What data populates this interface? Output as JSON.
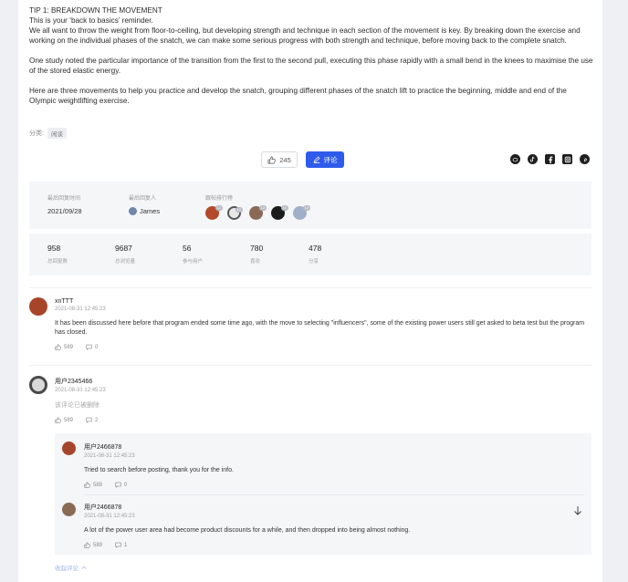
{
  "article": {
    "heading": "TIP 1: BREAKDOWN THE MOVEMENT",
    "line2": "This is your ‘back to basics’ reminder.",
    "para1": "We all want to throw the weight from floor-to-ceiling, but developing strength and technique in each section of the movement is key. By breaking down the exercise and working on the individual phases of the snatch, we can make some serious progress with both strength and technique, before moving back to the complete snatch.",
    "para2": "One study noted the particular importance of the transition from the first to the second pull, executing this phase rapidly with a small bend in the knees to maximise the use of the stored elastic energy.",
    "para3": "Here are three movements to help you practice and develop the snatch, grouping different phases of the snatch lift to practice the beginning, middle and end of the Olympic weightlifting exercise."
  },
  "category": {
    "label": "分类:",
    "tag": "闲谈"
  },
  "actions": {
    "like_count": "245",
    "comment_label": "评论"
  },
  "share_icons": [
    "weibo-icon",
    "tiktok-icon",
    "facebook-icon",
    "instagram-icon",
    "pinterest-icon"
  ],
  "info": {
    "last_reply_label": "最后回复时间",
    "last_reply_value": "2021/09/28",
    "last_replier_label": "最后回复人",
    "last_replier_value": "James",
    "ranking_label": "跟帖排行榜",
    "ranking_badges": [
      "12",
      "12",
      "12",
      "12",
      "12"
    ]
  },
  "stats": [
    {
      "value": "958",
      "label": "总回复数"
    },
    {
      "value": "9687",
      "label": "总浏览量"
    },
    {
      "value": "56",
      "label": "参与用户"
    },
    {
      "value": "780",
      "label": "喜欢"
    },
    {
      "value": "478",
      "label": "分享"
    }
  ],
  "comments": [
    {
      "name": "xnTTT",
      "time": "2021-08-31 12:45:23",
      "text": "It has been discussed here before that program ended some time ago, with the move to selecting \"influencers\", some of the existing power users still get asked to beta test but the program has closed.",
      "likes": "589",
      "replies": "0"
    },
    {
      "name": "用户2345466",
      "time": "2021-08-31 12:45:23",
      "text": "该评论已被删除",
      "likes": "589",
      "replies": "2"
    }
  ],
  "replies": [
    {
      "name": "用户2466878",
      "time": "2021-08-31 12:45:23",
      "text": "Tried to search before posting, thank you for the info.",
      "likes": "589",
      "replies": "0"
    },
    {
      "name": "用户2466878",
      "time": "2021-08-31 12:45:23",
      "text": "A lot of the power user area had become product discounts for a while, and then dropped into being almost nothing.",
      "likes": "589",
      "replies": "1"
    }
  ],
  "collapse_label": "收起评论",
  "colors": {
    "accent": "#2f5bea",
    "panel": "#f5f6f8",
    "page_bg": "#eef0f4"
  }
}
